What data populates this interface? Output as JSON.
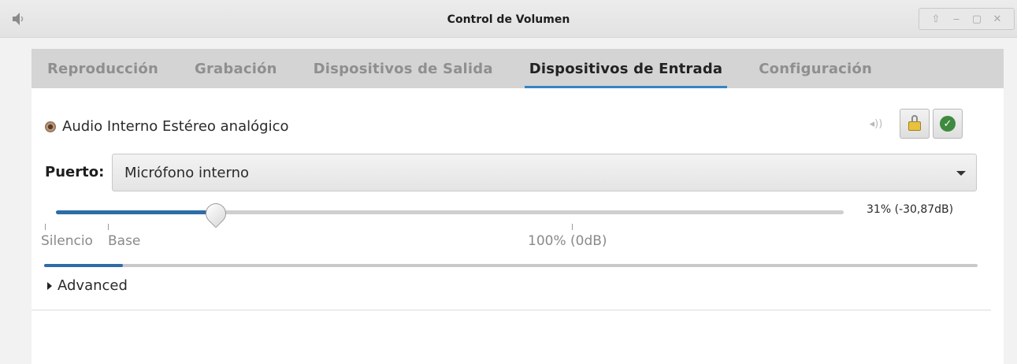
{
  "window": {
    "title": "Control de Volumen",
    "app_icon": "speaker-icon",
    "controls": [
      "up-arrow-icon",
      "minimize-icon",
      "maximize-icon",
      "close-icon"
    ]
  },
  "tabs": [
    {
      "label": "Reproducción",
      "active": false
    },
    {
      "label": "Grabación",
      "active": false
    },
    {
      "label": "Dispositivos de Salida",
      "active": false
    },
    {
      "label": "Dispositivos de Entrada",
      "active": true
    },
    {
      "label": "Configuración",
      "active": false
    }
  ],
  "device": {
    "name": "Audio Interno Estéreo analógico",
    "icon": "microphone-icon",
    "port_label": "Puerto:",
    "port_value": "Micrófono interno",
    "volume_text": "31% (-30,87dB)",
    "volume_fraction": 0.31,
    "level_fraction": 0.084,
    "ticks": [
      {
        "label": "Silencio"
      },
      {
        "label": "Base"
      },
      {
        "label": "100% (0dB)"
      }
    ],
    "advanced_label": "Advanced"
  },
  "colors": {
    "accent": "#3584c4",
    "slider_fill": "#2e6ca8"
  }
}
